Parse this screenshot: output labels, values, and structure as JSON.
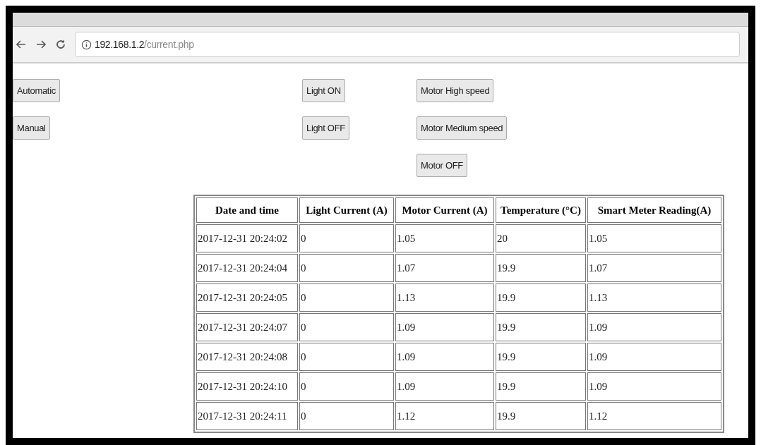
{
  "browser": {
    "address_host": "192.168.1.2",
    "address_path": "/current.php"
  },
  "mode_buttons": [
    "Automatic",
    "Manual"
  ],
  "light_buttons": [
    "Light ON",
    "Light OFF"
  ],
  "motor_buttons": [
    "Motor High speed",
    "Motor Medium speed",
    "Motor OFF"
  ],
  "table": {
    "columns": [
      "Date and time",
      "Light Current (A)",
      "Motor Current (A)",
      "Temperature (°C)",
      "Smart Meter Reading(A)"
    ],
    "rows": [
      [
        "2017-12-31 20:24:02",
        "0",
        "1.05",
        "20",
        "1.05"
      ],
      [
        "2017-12-31 20:24:04",
        "0",
        "1.07",
        "19.9",
        "1.07"
      ],
      [
        "2017-12-31 20:24:05",
        "0",
        "1.13",
        "19.9",
        "1.13"
      ],
      [
        "2017-12-31 20:24:07",
        "0",
        "1.09",
        "19.9",
        "1.09"
      ],
      [
        "2017-12-31 20:24:08",
        "0",
        "1.09",
        "19.9",
        "1.09"
      ],
      [
        "2017-12-31 20:24:10",
        "0",
        "1.09",
        "19.9",
        "1.09"
      ],
      [
        "2017-12-31 20:24:11",
        "0",
        "1.12",
        "19.9",
        "1.12"
      ]
    ]
  }
}
